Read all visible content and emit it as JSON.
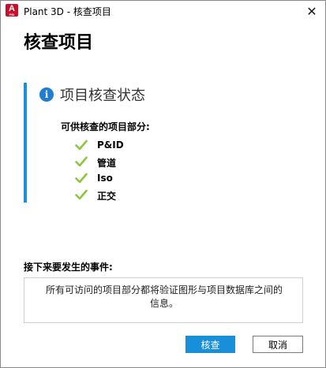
{
  "window": {
    "title": "Plant 3D - 核查项目",
    "app_icon_letter": "A",
    "app_icon_sub": "PID",
    "close_glyph": "✕"
  },
  "dialog": {
    "heading": "核查项目"
  },
  "status_panel": {
    "info_glyph": "i",
    "title": "项目核查状态",
    "parts_label": "可供核查的项目部分:",
    "parts": [
      {
        "label": "P&ID",
        "icon": "check-icon"
      },
      {
        "label": "管道",
        "icon": "check-icon"
      },
      {
        "label": "Iso",
        "icon": "check-icon"
      },
      {
        "label": "正交",
        "icon": "check-icon"
      }
    ]
  },
  "next": {
    "label": "接下来要发生的事件:",
    "description": "所有可访问的项目部分都将验证图形与项目数据库之间的信息。"
  },
  "buttons": {
    "check": "核查",
    "cancel": "取消"
  },
  "colors": {
    "accent": "#1a8fd9",
    "check_green": "#8dc63f",
    "app_red": "#c8102e"
  }
}
